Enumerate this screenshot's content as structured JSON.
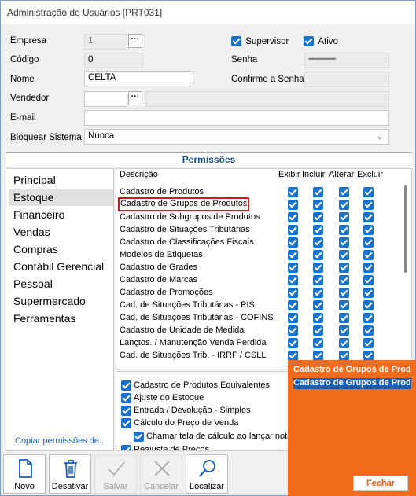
{
  "window": {
    "title": "Administração de Usuários [PRT031]"
  },
  "form": {
    "empresa_label": "Empresa",
    "empresa_value": "1",
    "codigo_label": "Código",
    "codigo_value": "0",
    "nome_label": "Nome",
    "nome_value": "CELTA",
    "vendedor_label": "Vendedor",
    "vendedor_value": "",
    "email_label": "E-mail",
    "email_value": "",
    "bloquear_label": "Bloquear Sistema",
    "bloquear_value": "Nunca",
    "supervisor_label": "Supervisor",
    "supervisor_checked": true,
    "ativo_label": "Ativo",
    "ativo_checked": true,
    "senha_label": "Senha",
    "senha_value": "••••••••••••••••",
    "confirme_label": "Confirme a Senha",
    "confirme_value": "",
    "dots": "···"
  },
  "permissions": {
    "header": "Permissões",
    "categories": [
      "Principal",
      "Estoque",
      "Financeiro",
      "Vendas",
      "Compras",
      "Contábil Gerencial",
      "Pessoal",
      "Supermercado",
      "Ferramentas"
    ],
    "selected_category": "Estoque",
    "copy_link": "Copiar permissões de...",
    "columns": {
      "descricao": "Descrição",
      "exibir": "Exibir",
      "incluir": "Incluir",
      "alterar": "Alterar",
      "excluir": "Excluir"
    },
    "rows": [
      "Cadastro de Produtos",
      "Cadastro de Grupos de Produtos",
      "Cadastro de Subgrupos de Produtos",
      "Cadastro de Situações Tributárias",
      "Cadastro de Classificações Fiscais",
      "Modelos de Etiquetas",
      "Cadastro de Grades",
      "Cadastro de Marcas",
      "Cadastro de Promoções",
      "Cad. de Situações Tributárias - PIS",
      "Cad. de Situações Tributárias - COFINS",
      "Cadastro de Unidade de Medida",
      "Lançtos. / Manutenção Venda Perdida",
      "Cad. de Situações Trib. - IRRF / CSLL"
    ],
    "highlighted_row": "Cadastro de Grupos de Produtos",
    "extra_options": [
      "Cadastro de Produtos Equivalentes",
      "Ajuste do Estoque",
      "Entrada / Devolução - Simples",
      "Cálculo do Preço de Venda",
      "Chamar tela de cálculo ao lançar notas",
      "Reajuste de Preços"
    ]
  },
  "toolbar": {
    "novo": "Novo",
    "desativar": "Desativar",
    "salvar": "Salvar",
    "cancelar": "Cancelar",
    "localizar": "Localizar"
  },
  "popup": {
    "line1": "Cadastro de Grupos de Produtos",
    "line2": "Cadastro de Grupos de Produtos",
    "close_label": "Fechar"
  },
  "colors": {
    "accent": "#1a73c8",
    "popup": "#f26b1d",
    "highlight": "#d21919",
    "link": "#1a5fb4"
  }
}
